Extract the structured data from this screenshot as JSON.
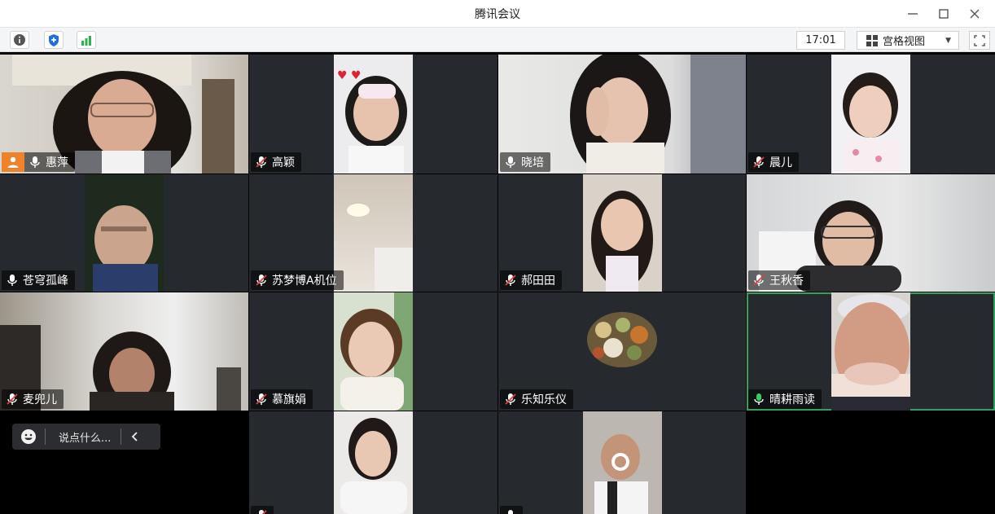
{
  "window": {
    "title": "腾讯会议"
  },
  "toolbar": {
    "time": "17:01",
    "view_mode": "宫格视图"
  },
  "participants": [
    {
      "name": "惠萍",
      "muted": false,
      "host": true
    },
    {
      "name": "高颖",
      "muted": true
    },
    {
      "name": "晓培",
      "muted": false
    },
    {
      "name": "晨儿",
      "muted": true
    },
    {
      "name": "苍穹孤峰",
      "muted": false
    },
    {
      "name": "苏梦博A机位",
      "muted": true
    },
    {
      "name": "郝田田",
      "muted": true
    },
    {
      "name": "王秋香",
      "muted": true
    },
    {
      "name": "麦兜儿",
      "muted": true
    },
    {
      "name": "慕旗娟",
      "muted": true
    },
    {
      "name": "乐知乐仪",
      "muted": true
    },
    {
      "name": "晴耕雨读",
      "muted": false,
      "speaking": true
    }
  ],
  "chat": {
    "placeholder": "说点什么..."
  },
  "colors": {
    "host_badge": "#f0822c",
    "active_speaker": "#2fa35c",
    "signal": "#2cb34a",
    "security": "#1e6fe6"
  }
}
